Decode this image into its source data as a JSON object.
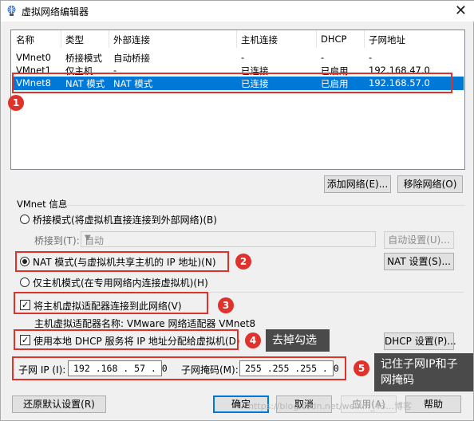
{
  "window": {
    "title": "虚拟网络编辑器",
    "close_glyph": "✕",
    "icon": "network-globe-icon"
  },
  "table": {
    "headers": [
      "名称",
      "类型",
      "外部连接",
      "主机连接",
      "DHCP",
      "子网地址"
    ],
    "rows": [
      [
        "VMnet0",
        "桥接模式",
        "自动桥接",
        "-",
        "-",
        "-"
      ],
      [
        "VMnet1",
        "仅主机...",
        "-",
        "已连接",
        "已启用",
        "192.168.47.0"
      ],
      [
        "VMnet8",
        "NAT 模式",
        "NAT 模式",
        "已连接",
        "已启用",
        "192.168.57.0"
      ]
    ],
    "selected_index": 2
  },
  "buttons": {
    "add_network": "添加网络(E)...",
    "remove_network": "移除网络(O)",
    "auto_settings": "自动设置(U)...",
    "nat_settings": "NAT 设置(S)...",
    "dhcp_settings": "DHCP 设置(P)...",
    "restore_defaults": "还原默认设置(R)",
    "ok": "确定",
    "cancel": "取消",
    "apply": "应用(A)",
    "help": "帮助"
  },
  "vmnet_info": {
    "group_label": "VMnet 信息",
    "bridge_radio": "桥接模式(将虚拟机直接连接到外部网络)(B)",
    "bridge_to_label": "桥接到(T):",
    "bridge_to_value": "自动",
    "nat_radio": "NAT 模式(与虚拟机共享主机的 IP 地址)(N)",
    "host_only_radio": "仅主机模式(在专用网络内连接虚拟机)(H)",
    "selected_mode": "nat",
    "connect_adapter_check": "将主机虚拟适配器连接到此网络(V)",
    "connect_adapter_checked": true,
    "adapter_name_text": "主机虚拟适配器名称: VMware 网络适配器 VMnet8",
    "dhcp_check": "使用本地 DHCP 服务将 IP 地址分配给虚拟机(D)",
    "dhcp_checked": true,
    "subnet_ip_label": "子网 IP (I):",
    "subnet_ip_value": "192 .168 . 57 . 0",
    "subnet_mask_label": "子网掩码(M):",
    "subnet_mask_value": "255 .255 .255 . 0"
  },
  "annotations": {
    "badges": [
      "1",
      "2",
      "3",
      "4",
      "5"
    ],
    "callout_4": "去掉勾选",
    "callout_5": "记住子网IP和子网掩码",
    "watermark": "https://blog.csdn.net/weixin_43...博客",
    "accent": "#e0322c"
  }
}
